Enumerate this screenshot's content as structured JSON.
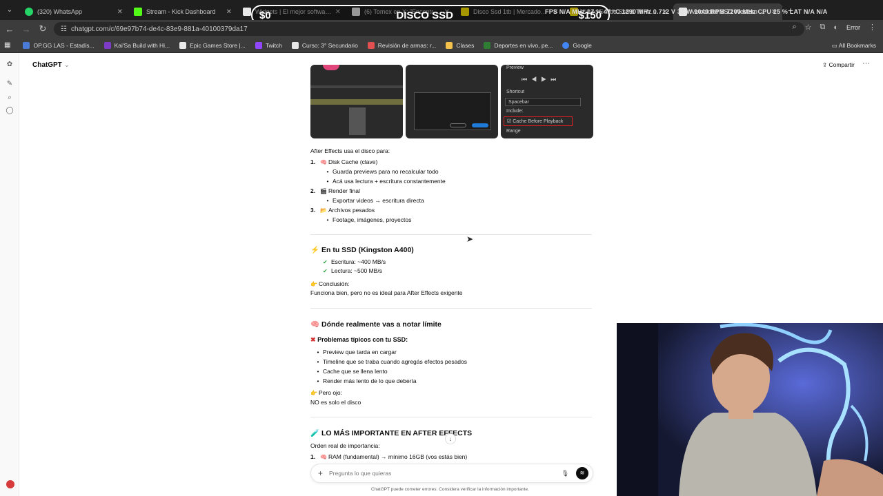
{
  "browser": {
    "tabs": [
      {
        "title": "(320) WhatsApp",
        "color": "#25d366"
      },
      {
        "title": "Stream - Kick Dashboard",
        "color": "#53fc18"
      },
      {
        "title": "Widgets | El mejor software pa",
        "color": "#e8e8e8"
      },
      {
        "title": "(6) Tomex en X: \"Encontré $20",
        "color": "#e8e8e8"
      },
      {
        "title": "Disco Ssd 1tb | MercadoLibre",
        "color": "#ffe600"
      },
      {
        "title": "Disco Solido Ssd 1 Tb Western",
        "color": "#ffe600"
      },
      {
        "title": "Velocidad SSD Western Digital",
        "color": "#e8e8e8"
      }
    ],
    "url": "chatgpt.com/c/69e97b74-de4c-83e9-881a-40100379da17",
    "error_label": "Error",
    "bookmarks": [
      {
        "label": "OP.GG LAS - Estadís...",
        "color": "#4a7bd6"
      },
      {
        "label": "Kai'Sa Build with Hi...",
        "color": "#7d3cc8"
      },
      {
        "label": "Epic Games Store |...",
        "color": "#e8e8e8"
      },
      {
        "label": "Twitch",
        "color": "#9146ff"
      },
      {
        "label": "Curso: 3° Secundario",
        "color": "#e8e8e8"
      },
      {
        "label": "Revisión de armas: r...",
        "color": "#e05050"
      },
      {
        "label": "Clases",
        "color": "#f2c24b"
      },
      {
        "label": "Deportes en vivo, pe...",
        "color": "#2e7d32"
      },
      {
        "label": "Google",
        "color": "#4285f4"
      }
    ],
    "all_bookmarks": "All Bookmarks"
  },
  "overlay": {
    "left": "$0",
    "title": "DISCO SSD",
    "right": "$150",
    "hw_stats": "FPS  N/A  MHz  17 % 47 °C  1290 MHz  0.712 V  33 W  1040 RPM  7200 MHz  CPU 25 %  LAT  N/A  N/A"
  },
  "app": {
    "model_label": "ChatGPT",
    "share_label": "Compartir",
    "more_label": "···"
  },
  "thumb3": {
    "preview": "Preview",
    "shortcut": "Shortcut",
    "shortcut_value": "Spacebar",
    "include": "Include:",
    "cache_option": "Cache Before Playback",
    "range": "Range"
  },
  "message": {
    "intro": "After Effects usa el disco para:",
    "uses": [
      {
        "num": "1.",
        "emoji": "🧠",
        "title": "Disk Cache (clave)",
        "items": [
          "Guarda previews para no recalcular todo",
          "Acá usa lectura + escritura constantemente"
        ]
      },
      {
        "num": "2.",
        "emoji": "🎬",
        "title": "Render final",
        "items": [
          "Exportar videos → escritura directa"
        ]
      },
      {
        "num": "3.",
        "emoji": "📂",
        "title": "Archivos pesados",
        "items": [
          "Footage, imágenes, proyectos"
        ]
      }
    ],
    "ssd_heading": "En tu SSD (Kingston A400)",
    "ssd_emoji": "⚡",
    "ssd_specs": [
      "Escritura: ~400 MB/s",
      "Lectura: ~500 MB/s"
    ],
    "conclusion_label": "Conclusión:",
    "conclusion_text": "Funciona bien, pero no es ideal para After Effects exigente",
    "limit_heading": "Dónde realmente vas a notar límite",
    "limit_emoji": "🧠",
    "problems_heading": "Problemas típicos con tu SSD:",
    "problems": [
      "Preview que tarda en cargar",
      "Timeline que se traba cuando agregás efectos pesados",
      "Cache que se llena lento",
      "Render más lento de lo que debería"
    ],
    "but_label": "Pero ojo:",
    "but_text": "NO es solo el disco",
    "important_heading": "LO MÁS IMPORTANTE EN AFTER EFFECTS",
    "important_emoji": "🧪",
    "order_label": "Orden real de importancia:",
    "order_first": "RAM (fundamental) → mínimo 16GB (vos estás bien)"
  },
  "composer": {
    "placeholder": "Pregunta lo que quieras"
  },
  "disclaimer": "ChatGPT puede cometer errores. Considera verificar la información importante."
}
